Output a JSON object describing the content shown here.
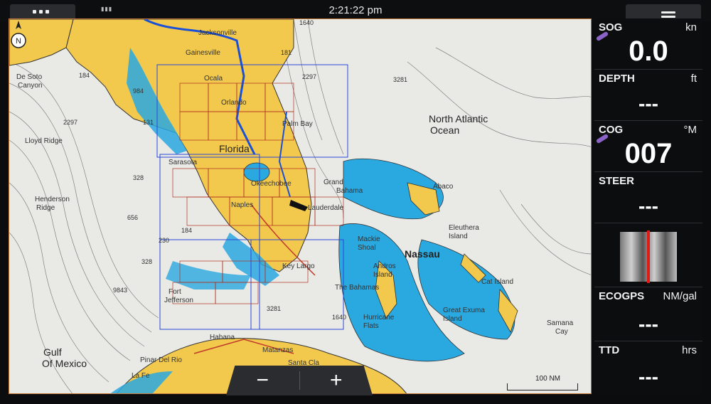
{
  "topbar": {
    "time": "2:21:22 pm",
    "apps_icon": "apps-grid-icon",
    "menu_icon": "hamburger-menu-icon"
  },
  "map": {
    "labels": {
      "florida": "Florida",
      "north_atlantic": "North Atlantic",
      "ocean": "Ocean",
      "nassau": "Nassau",
      "gulf": "Gulf",
      "of_mexico": "Of Mexico",
      "jacksonville": "Jacksonville",
      "gainesville": "Gainesville",
      "ocala": "Ocala",
      "orlando": "Orlando",
      "palm_bay": "Palm Bay",
      "sarasota": "Sarasota",
      "naples": "Naples",
      "fort_lauderdale": "Lauderdale",
      "key_largo": "Key Largo",
      "de_soto": "De Soto",
      "canyon": "Canyon",
      "lloyd_ridge": "Lloyd Ridge",
      "henderson": "Henderson",
      "ridge": "Ridge",
      "fort_jefferson": "Fort",
      "jefferson": "Jefferson",
      "habana": "Habana",
      "matanzas": "Matanzas",
      "santa_clara": "Santa Cla",
      "pinar": "Pinar Del Rio",
      "la_fe": "La Fe",
      "abaco": "Abaco",
      "eleuthera": "Eleuthera",
      "island": "Island",
      "mackie": "Mackie",
      "shoal": "Shoal",
      "andros": "Andros",
      "andros_island": "Island",
      "the_bahamas": "The Bahamas",
      "hurricane": "Hurricane",
      "flats": "Flats",
      "great_exuma": "Great Exuma",
      "exuma_island": "Island",
      "cat_island": "Cat Island",
      "samana": "Samana",
      "cay": "Cay",
      "grand": "Grand",
      "bahama": "Bahama",
      "okeechobee": "Okeechobee",
      "d_2297a": "2297",
      "d_2297b": "2297",
      "d_3281a": "3281",
      "d_3281b": "3281",
      "d_1640a": "1640",
      "d_1640b": "1640",
      "d_181": "181",
      "d_184a": "184",
      "d_184b": "184",
      "d_984": "984",
      "d_131": "131",
      "d_328a": "328",
      "d_328b": "328",
      "d_656": "656",
      "d_230": "230",
      "d_9843": "9843"
    },
    "scale": "100 NM",
    "north_icon": "north-arrow-icon"
  },
  "zoom": {
    "out_label": "−",
    "in_label": "+"
  },
  "instruments": [
    {
      "label": "SOG",
      "unit": "kn",
      "value": "0.0"
    },
    {
      "label": "DEPTH",
      "unit": "ft",
      "value": "---"
    },
    {
      "label": "COG",
      "unit": "°M",
      "value": "007"
    },
    {
      "label": "STEER",
      "unit": "",
      "value": "---"
    },
    {
      "label": "ECOGPS",
      "unit": "NM/gal",
      "value": "---"
    },
    {
      "label": "TTD",
      "unit": "hrs",
      "value": "---"
    }
  ]
}
